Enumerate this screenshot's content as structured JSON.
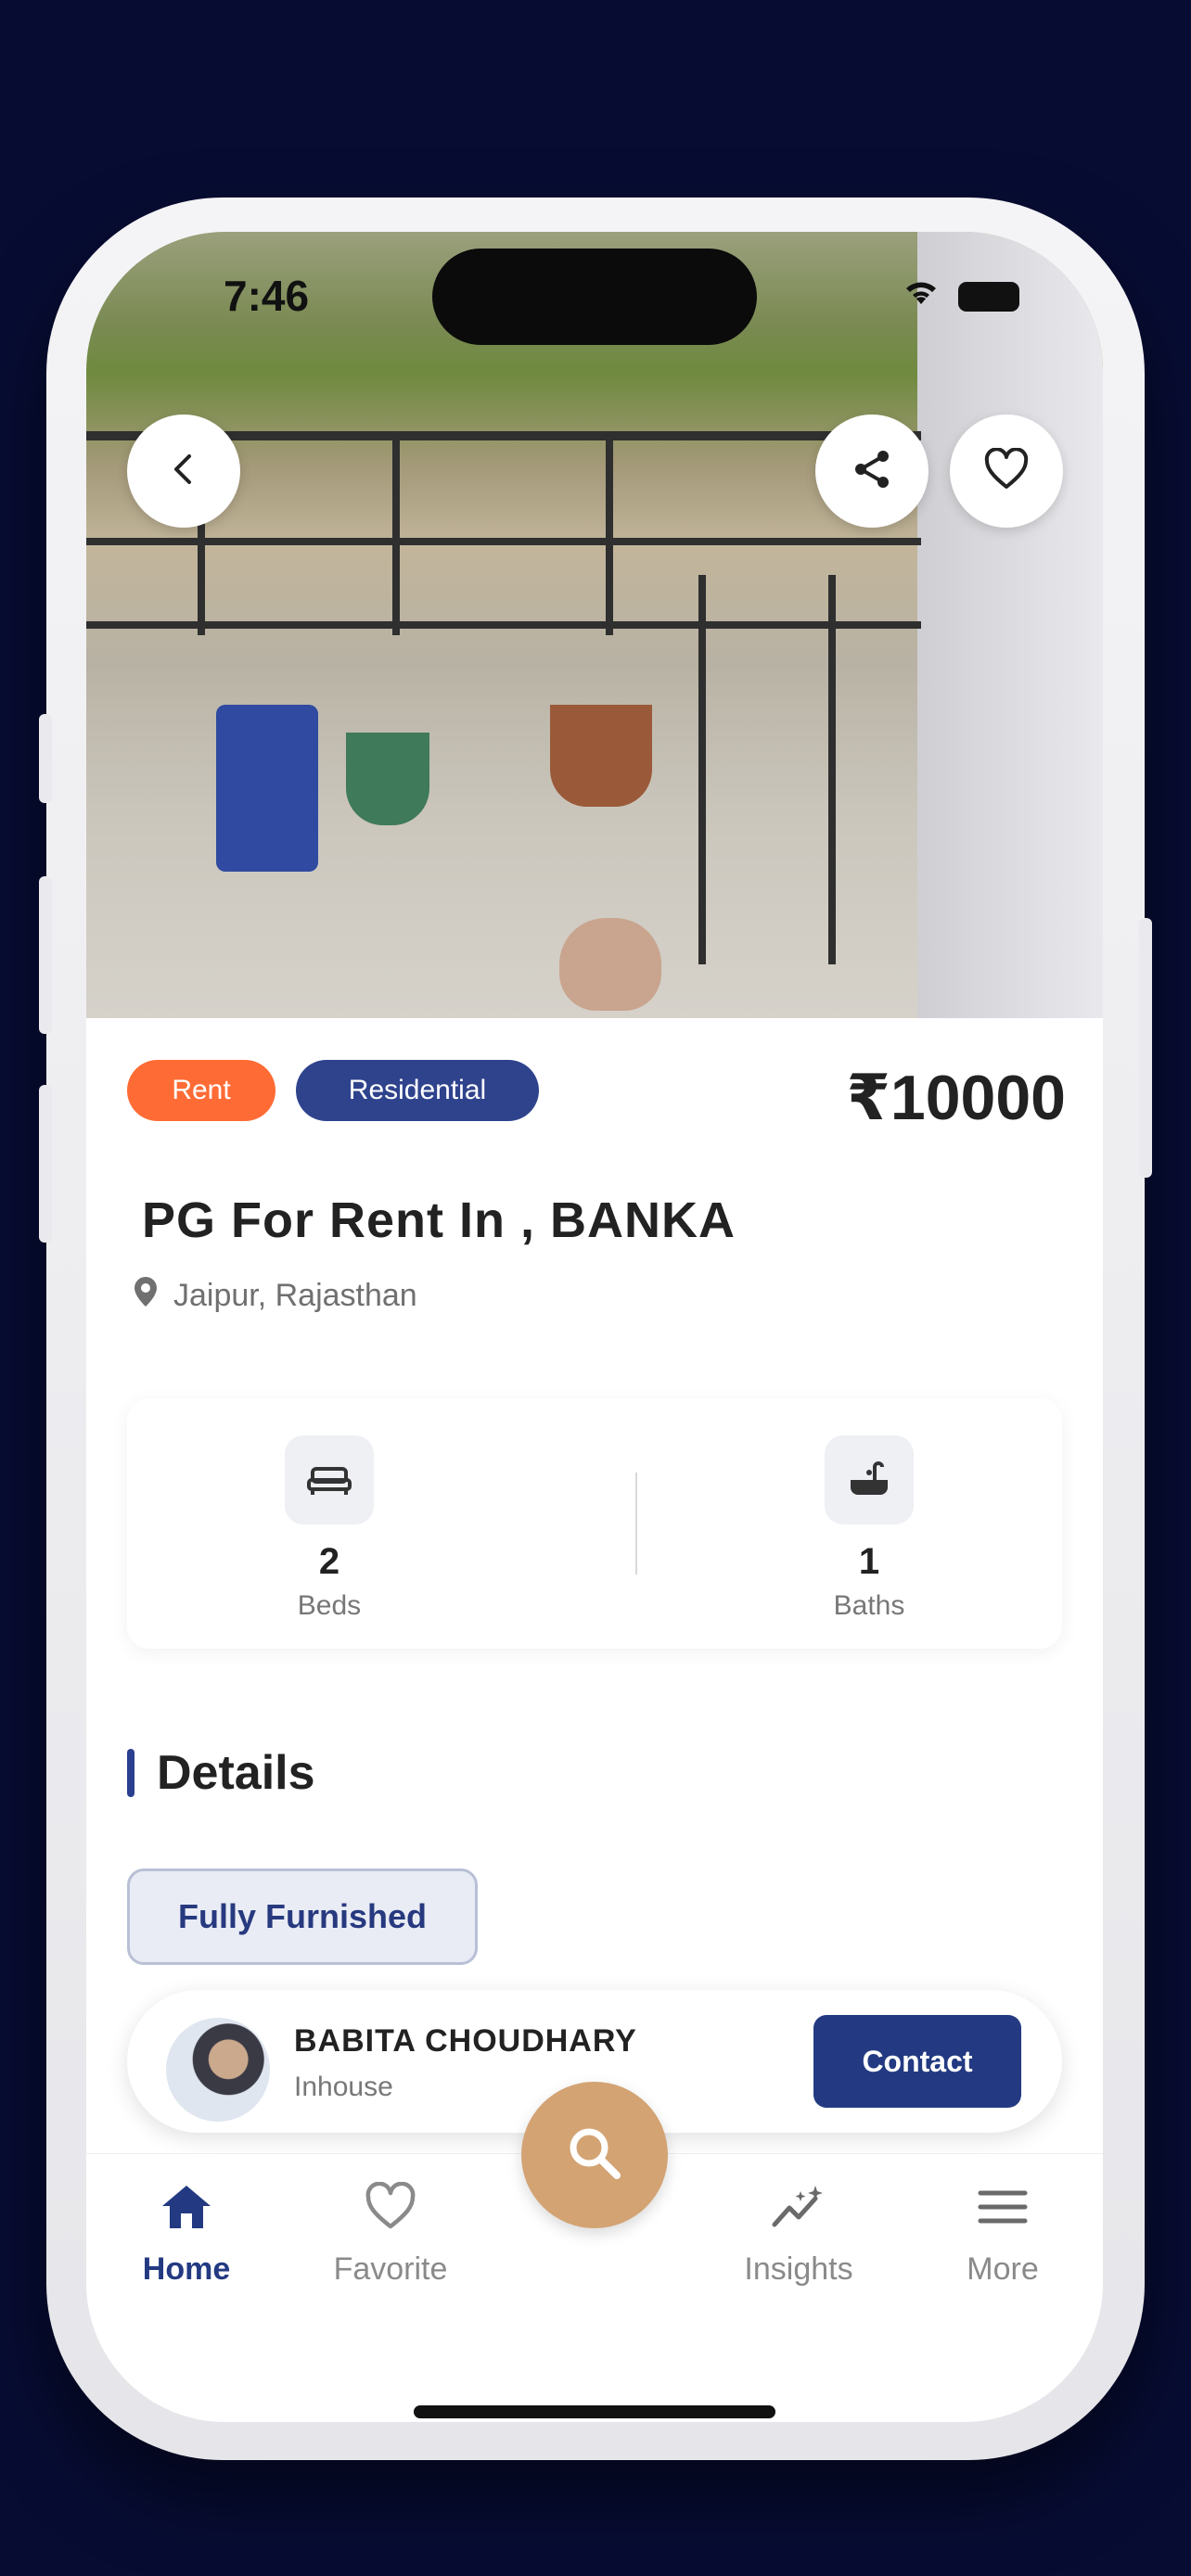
{
  "status_bar": {
    "time": "7:46"
  },
  "listing": {
    "tags": [
      "Rent",
      "Residential"
    ],
    "price": "₹10000",
    "title": "PG For Rent In , BANKA",
    "location": "Jaipur, Rajasthan"
  },
  "stats": {
    "beds": {
      "value": "2",
      "label": "Beds"
    },
    "baths": {
      "value": "1",
      "label": "Baths"
    }
  },
  "details": {
    "heading": "Details",
    "chips": [
      "Fully Furnished"
    ]
  },
  "agent": {
    "name": "BABITA CHOUDHARY",
    "type": "Inhouse",
    "contact_label": "Contact"
  },
  "nav": {
    "items": [
      {
        "label": "Home",
        "icon": "home-icon",
        "active": true
      },
      {
        "label": "Favorite",
        "icon": "heart-icon",
        "active": false
      },
      {
        "label": "Insights",
        "icon": "insights-icon",
        "active": false
      },
      {
        "label": "More",
        "icon": "menu-icon",
        "active": false
      }
    ]
  },
  "colors": {
    "background": "#070c33",
    "rent_tag": "#ff6b35",
    "residential_tag": "#2f438d",
    "primary": "#233a82",
    "fab": "#d3a373"
  },
  "icons": {
    "back": "chevron-left-icon",
    "share": "share-icon",
    "favorite": "heart-icon",
    "location": "location-pin-icon",
    "beds": "bed-icon",
    "baths": "bathtub-icon",
    "search": "search-icon"
  }
}
